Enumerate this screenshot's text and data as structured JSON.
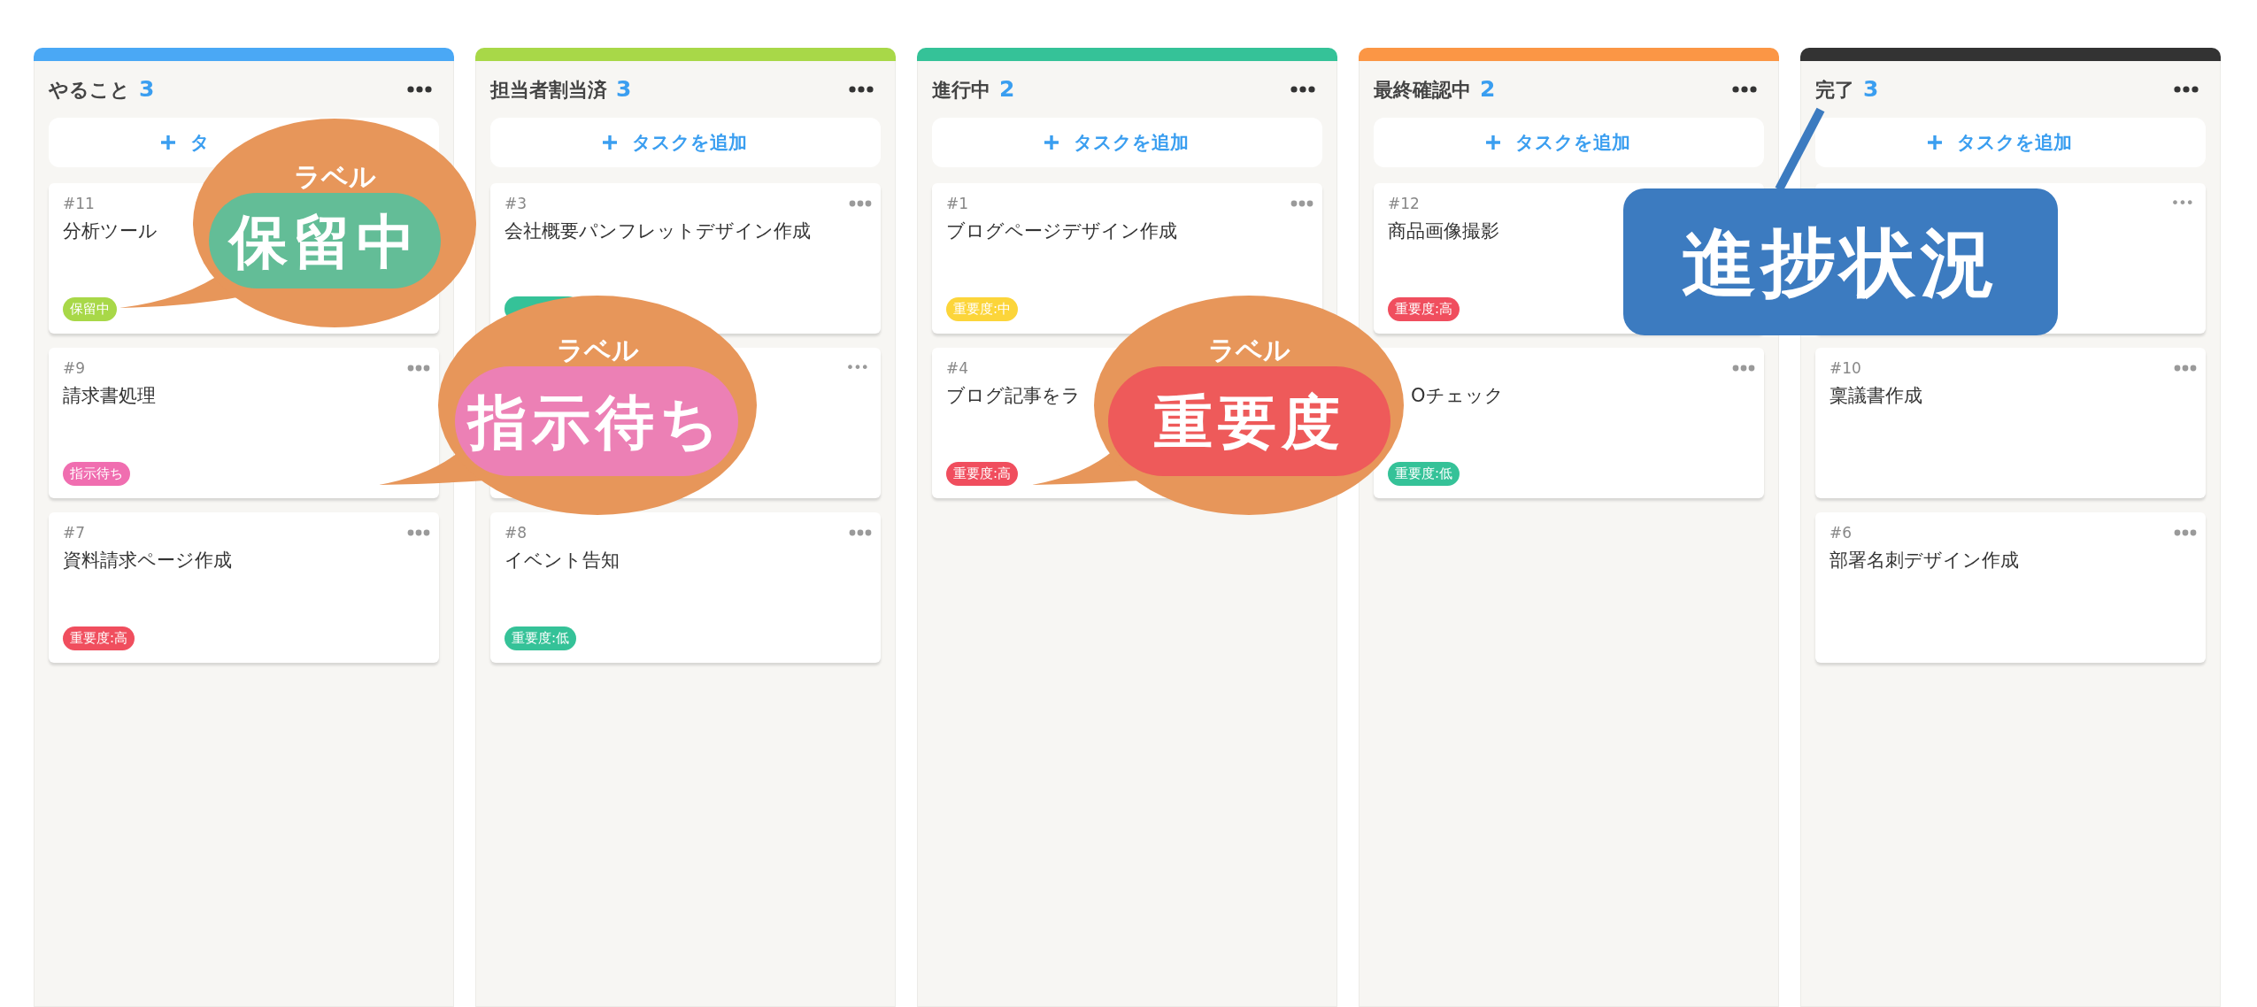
{
  "columns": [
    {
      "title": "やること",
      "count": "3",
      "color": "#4aa8f5",
      "add_label": "タ",
      "cards": [
        {
          "number": "#11",
          "title": "分析ツール",
          "labels": [
            {
              "text": "保留中",
              "color": "#a8d848"
            }
          ]
        },
        {
          "number": "#9",
          "title": "請求書処理",
          "labels": [
            {
              "text": "指示待ち",
              "color": "#f06eb0"
            }
          ]
        },
        {
          "number": "#7",
          "title": "資料請求ページ作成",
          "labels": [
            {
              "text": "重要度:高",
              "color": "#f04e5e"
            }
          ]
        }
      ]
    },
    {
      "title": "担当者割当済",
      "count": "3",
      "color": "#a8d848",
      "add_label": "タスクを追加",
      "cards": [
        {
          "number": "#3",
          "title": "会社概要パンフレットデザイン作成",
          "labels": [
            {
              "color": "#35c298"
            }
          ]
        },
        {
          "menu": "•••"
        },
        {
          "number": "#8",
          "title": "イベント告知",
          "labels": [
            {
              "text": "重要度:低",
              "color": "#35c298"
            }
          ]
        }
      ]
    },
    {
      "title": "進行中",
      "count": "2",
      "color": "#35c298",
      "add_label": "タスクを追加",
      "cards": [
        {
          "number": "#1",
          "title": "ブログページデザイン作成",
          "labels": [
            {
              "text": "重要度:中",
              "color": "#fcd53a"
            }
          ]
        },
        {
          "number": "#4",
          "title": "ブログ記事をラ",
          "labels": [
            {
              "text": "重要度:高",
              "color": "#f04e5e"
            }
          ]
        }
      ]
    },
    {
      "title": "最終確認中",
      "count": "2",
      "color": "#fb9645",
      "add_label": "タスクを追加",
      "cards": [
        {
          "number": "#12",
          "title": "商品画像撮影",
          "labels": [
            {
              "text": "重要度:高",
              "color": "#f04e5e"
            }
          ]
        },
        {
          "title": "Oチェック",
          "labels": [
            {
              "text": "重要度:低",
              "color": "#35c298"
            }
          ]
        }
      ]
    },
    {
      "title": "完了",
      "count": "3",
      "color": "#333333",
      "add_label": "タスクを追加",
      "cards": [
        {
          "menu": "•••"
        },
        {
          "number": "#10",
          "title": "稟議書作成"
        },
        {
          "number": "#6",
          "title": "部署名刺デザイン作成"
        }
      ]
    }
  ],
  "callouts": [
    {
      "kind": "bubble",
      "caption": "ラベル",
      "text": "保留中",
      "color": "#63bd97"
    },
    {
      "kind": "bubble",
      "caption": "ラベル",
      "text": "指示待ち",
      "color": "#ec80b5"
    },
    {
      "kind": "bubble",
      "caption": "ラベル",
      "text": "重要度",
      "color": "#ee5a5a"
    },
    {
      "kind": "box",
      "text": "進捗状況",
      "color": "#3c7bc0"
    }
  ]
}
